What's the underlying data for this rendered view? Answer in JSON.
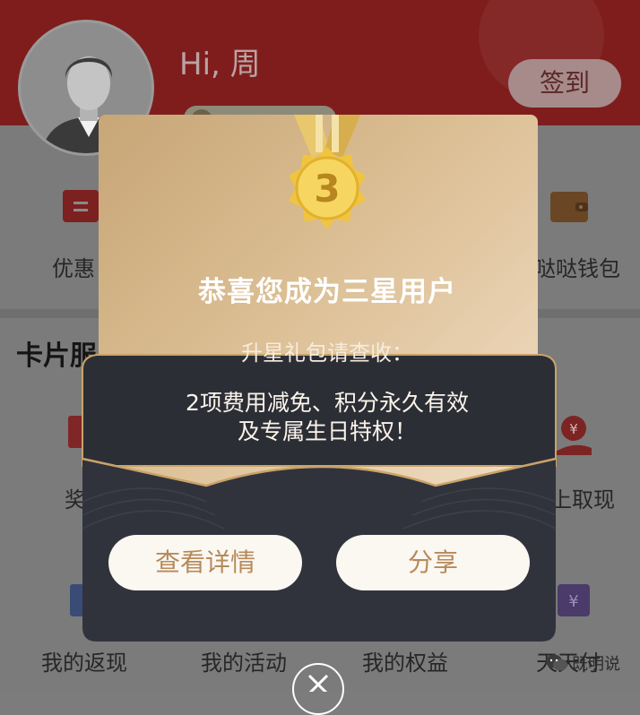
{
  "header": {
    "greeting": "Hi, 周",
    "signin_label": "签到"
  },
  "top_row": {
    "left_label": "优惠",
    "right_label": "哒哒钱包"
  },
  "section_title": "卡片服",
  "grid_row2": {
    "left_label": "奖",
    "right_label": "上取现"
  },
  "grid_row3": {
    "items": [
      "我的返现",
      "我的活动",
      "我的权益",
      "天天付"
    ]
  },
  "modal": {
    "medal_number": "3",
    "title": "恭喜您成为三星用户",
    "subtitle": "升星礼包请查收：",
    "description_line1": "2项费用减免、积分永久有效",
    "description_line2": "及专属生日特权！",
    "details_button": "查看详情",
    "share_button": "分享"
  },
  "watermark": {
    "text": "既明说"
  },
  "colors": {
    "header_red": "#7f1d1d",
    "gold": "#c7a677",
    "envelope": "#2c2e36",
    "button_text": "#b68a5b"
  }
}
